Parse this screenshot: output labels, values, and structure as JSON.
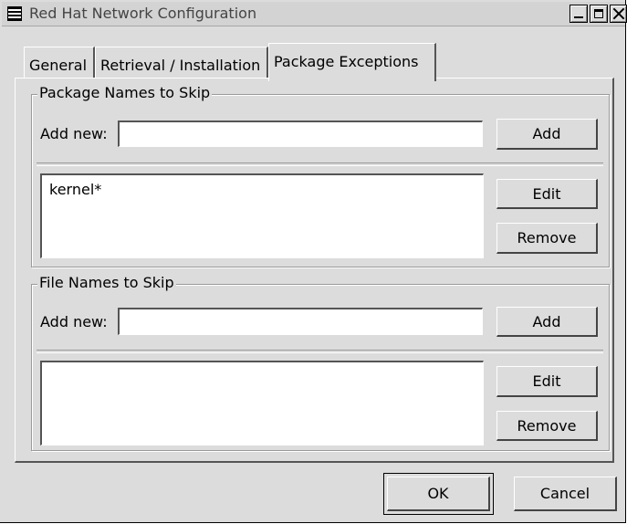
{
  "window": {
    "title": "Red Hat Network Configuration"
  },
  "tabs": [
    {
      "label": "General"
    },
    {
      "label": "Retrieval / Installation"
    },
    {
      "label": "Package Exceptions"
    }
  ],
  "package_section": {
    "title": "Package Names to Skip",
    "add_label": "Add new:",
    "input_value": "",
    "add_button": "Add",
    "items": [
      "kernel*"
    ],
    "edit_button": "Edit",
    "remove_button": "Remove"
  },
  "file_section": {
    "title": "File Names to Skip",
    "add_label": "Add new:",
    "input_value": "",
    "add_button": "Add",
    "items": [],
    "edit_button": "Edit",
    "remove_button": "Remove"
  },
  "footer": {
    "ok_button": "OK",
    "cancel_button": "Cancel"
  }
}
